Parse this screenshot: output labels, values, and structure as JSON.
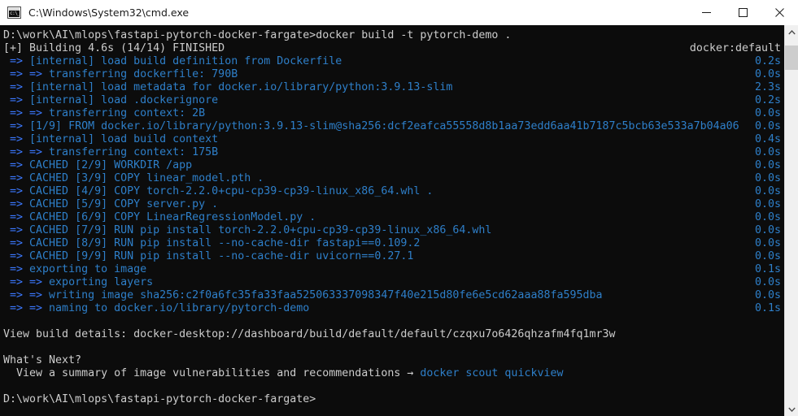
{
  "window": {
    "title": "C:\\Windows\\System32\\cmd.exe",
    "icon": "cmd-console-icon",
    "icon_text": "c:\\_",
    "background_color": "#0c0c0c",
    "titlebar_color": "#ffffff"
  },
  "controls": {
    "minimize": "minimize-icon",
    "maximize": "maximize-icon",
    "close": "close-icon"
  },
  "colors": {
    "text": "#cccccc",
    "arrow_blue": "#3b78ff",
    "step_blue": "#2e7fc9",
    "timing_blue": "#2e7fc9"
  },
  "scrollbar": {
    "up_arrow": "chevron-up-icon",
    "down_arrow": "chevron-down-icon",
    "thumb_position_percent": 2
  },
  "console": {
    "lines": [
      {
        "segments": [
          {
            "t": "D:\\work\\AI\\mlops\\fastapi-pytorch-docker-fargate>docker build -t pytorch-demo .",
            "c": "c-white"
          }
        ],
        "timing": "",
        "timing_class": "c-time"
      },
      {
        "segments": [
          {
            "t": "[+] Building 4.6s (14/14) FINISHED",
            "c": "c-white"
          }
        ],
        "timing": "docker:default",
        "timing_class": "c-white"
      },
      {
        "segments": [
          {
            "t": " => ",
            "c": "c-arrow"
          },
          {
            "t": "[internal] load build definition from Dockerfile",
            "c": "c-blue"
          }
        ],
        "timing": "0.2s",
        "timing_class": "c-time"
      },
      {
        "segments": [
          {
            "t": " => => ",
            "c": "c-arrow"
          },
          {
            "t": "transferring dockerfile: 790B",
            "c": "c-blue"
          }
        ],
        "timing": "0.0s",
        "timing_class": "c-time"
      },
      {
        "segments": [
          {
            "t": " => ",
            "c": "c-arrow"
          },
          {
            "t": "[internal] load metadata for docker.io/library/python:3.9.13-slim",
            "c": "c-blue"
          }
        ],
        "timing": "2.3s",
        "timing_class": "c-time"
      },
      {
        "segments": [
          {
            "t": " => ",
            "c": "c-arrow"
          },
          {
            "t": "[internal] load .dockerignore",
            "c": "c-blue"
          }
        ],
        "timing": "0.2s",
        "timing_class": "c-time"
      },
      {
        "segments": [
          {
            "t": " => => ",
            "c": "c-arrow"
          },
          {
            "t": "transferring context: 2B",
            "c": "c-blue"
          }
        ],
        "timing": "0.0s",
        "timing_class": "c-time"
      },
      {
        "segments": [
          {
            "t": " => ",
            "c": "c-arrow"
          },
          {
            "t": "[1/9] FROM docker.io/library/python:3.9.13-slim@sha256:dcf2eafca55558d8b1aa73edd6aa41b7187c5bcb63e533a7b04a06",
            "c": "c-blue"
          }
        ],
        "timing": "0.0s",
        "timing_class": "c-time"
      },
      {
        "segments": [
          {
            "t": " => ",
            "c": "c-arrow"
          },
          {
            "t": "[internal] load build context",
            "c": "c-blue"
          }
        ],
        "timing": "0.4s",
        "timing_class": "c-time"
      },
      {
        "segments": [
          {
            "t": " => => ",
            "c": "c-arrow"
          },
          {
            "t": "transferring context: 175B",
            "c": "c-blue"
          }
        ],
        "timing": "0.0s",
        "timing_class": "c-time"
      },
      {
        "segments": [
          {
            "t": " => ",
            "c": "c-arrow"
          },
          {
            "t": "CACHED [2/9] WORKDIR /app",
            "c": "c-blue"
          }
        ],
        "timing": "0.0s",
        "timing_class": "c-time"
      },
      {
        "segments": [
          {
            "t": " => ",
            "c": "c-arrow"
          },
          {
            "t": "CACHED [3/9] COPY linear_model.pth .",
            "c": "c-blue"
          }
        ],
        "timing": "0.0s",
        "timing_class": "c-time"
      },
      {
        "segments": [
          {
            "t": " => ",
            "c": "c-arrow"
          },
          {
            "t": "CACHED [4/9] COPY torch-2.2.0+cpu-cp39-cp39-linux_x86_64.whl .",
            "c": "c-blue"
          }
        ],
        "timing": "0.0s",
        "timing_class": "c-time"
      },
      {
        "segments": [
          {
            "t": " => ",
            "c": "c-arrow"
          },
          {
            "t": "CACHED [5/9] COPY server.py .",
            "c": "c-blue"
          }
        ],
        "timing": "0.0s",
        "timing_class": "c-time"
      },
      {
        "segments": [
          {
            "t": " => ",
            "c": "c-arrow"
          },
          {
            "t": "CACHED [6/9] COPY LinearRegressionModel.py .",
            "c": "c-blue"
          }
        ],
        "timing": "0.0s",
        "timing_class": "c-time"
      },
      {
        "segments": [
          {
            "t": " => ",
            "c": "c-arrow"
          },
          {
            "t": "CACHED [7/9] RUN pip install torch-2.2.0+cpu-cp39-cp39-linux_x86_64.whl",
            "c": "c-blue"
          }
        ],
        "timing": "0.0s",
        "timing_class": "c-time"
      },
      {
        "segments": [
          {
            "t": " => ",
            "c": "c-arrow"
          },
          {
            "t": "CACHED [8/9] RUN pip install --no-cache-dir fastapi==0.109.2",
            "c": "c-blue"
          }
        ],
        "timing": "0.0s",
        "timing_class": "c-time"
      },
      {
        "segments": [
          {
            "t": " => ",
            "c": "c-arrow"
          },
          {
            "t": "CACHED [9/9] RUN pip install --no-cache-dir uvicorn==0.27.1",
            "c": "c-blue"
          }
        ],
        "timing": "0.0s",
        "timing_class": "c-time"
      },
      {
        "segments": [
          {
            "t": " => ",
            "c": "c-arrow"
          },
          {
            "t": "exporting to image",
            "c": "c-blue"
          }
        ],
        "timing": "0.1s",
        "timing_class": "c-time"
      },
      {
        "segments": [
          {
            "t": " => => ",
            "c": "c-arrow"
          },
          {
            "t": "exporting layers",
            "c": "c-blue"
          }
        ],
        "timing": "0.0s",
        "timing_class": "c-time"
      },
      {
        "segments": [
          {
            "t": " => => ",
            "c": "c-arrow"
          },
          {
            "t": "writing image sha256:c2f0a6fc35fa33faa525063337098347f40e215d80fe6e5cd62aaa88fa595dba",
            "c": "c-blue"
          }
        ],
        "timing": "0.0s",
        "timing_class": "c-time"
      },
      {
        "segments": [
          {
            "t": " => => ",
            "c": "c-arrow"
          },
          {
            "t": "naming to docker.io/library/pytorch-demo",
            "c": "c-blue"
          }
        ],
        "timing": "0.1s",
        "timing_class": "c-time"
      },
      {
        "segments": [
          {
            "t": "",
            "c": "c-white"
          }
        ],
        "timing": "",
        "timing_class": "c-time"
      },
      {
        "segments": [
          {
            "t": "View build details: docker-desktop://dashboard/build/default/default/czqxu7o6426qhzafm4fq1mr3w",
            "c": "c-white"
          }
        ],
        "timing": "",
        "timing_class": "c-time"
      },
      {
        "segments": [
          {
            "t": "",
            "c": "c-white"
          }
        ],
        "timing": "",
        "timing_class": "c-time"
      },
      {
        "segments": [
          {
            "t": "What's Next?",
            "c": "c-white"
          }
        ],
        "timing": "",
        "timing_class": "c-time"
      },
      {
        "segments": [
          {
            "t": "  View a summary of image vulnerabilities and recommendations → ",
            "c": "c-white"
          },
          {
            "t": "docker scout quickview",
            "c": "c-blue"
          }
        ],
        "timing": "",
        "timing_class": "c-time"
      },
      {
        "segments": [
          {
            "t": "",
            "c": "c-white"
          }
        ],
        "timing": "",
        "timing_class": "c-time"
      },
      {
        "segments": [
          {
            "t": "D:\\work\\AI\\mlops\\fastapi-pytorch-docker-fargate>",
            "c": "c-white"
          }
        ],
        "timing": "",
        "timing_class": "c-time"
      }
    ]
  }
}
